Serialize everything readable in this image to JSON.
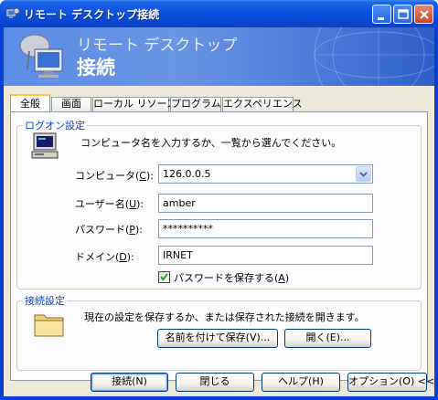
{
  "window": {
    "title": "リモート デスクトップ接続"
  },
  "banner": {
    "line1": "リモート デスクトップ",
    "line2": "接続"
  },
  "tabs": [
    {
      "label": "全般"
    },
    {
      "label": "画面"
    },
    {
      "label": "ローカル リソース"
    },
    {
      "label": "プログラム"
    },
    {
      "label": "エクスペリエンス"
    }
  ],
  "logon": {
    "title": "ログオン設定",
    "instruction": "コンピュータ名を入力するか、一覧から選んでください。",
    "computer": {
      "label": "コンピュータ",
      "accel": "C",
      "value": "126.0.0.5"
    },
    "username": {
      "label": "ユーザー名",
      "accel": "U",
      "value": "amber"
    },
    "password": {
      "label": "パスワード",
      "accel": "P",
      "value": "**********"
    },
    "domain": {
      "label": "ドメイン",
      "accel": "D",
      "value": "IRNET"
    },
    "save_password": {
      "label": "パスワードを保存する",
      "accel": "A",
      "checked": true
    }
  },
  "connection": {
    "title": "接続設定",
    "instruction": "現在の設定を保存するか、または保存された接続を開きます。",
    "save_as_button": "名前を付けて保存(V)...",
    "open_button": "開く(E)..."
  },
  "buttons": {
    "connect": "接続(N)",
    "close": "閉じる",
    "help": "ヘルプ(H)",
    "options": "オプション(O) <<"
  }
}
